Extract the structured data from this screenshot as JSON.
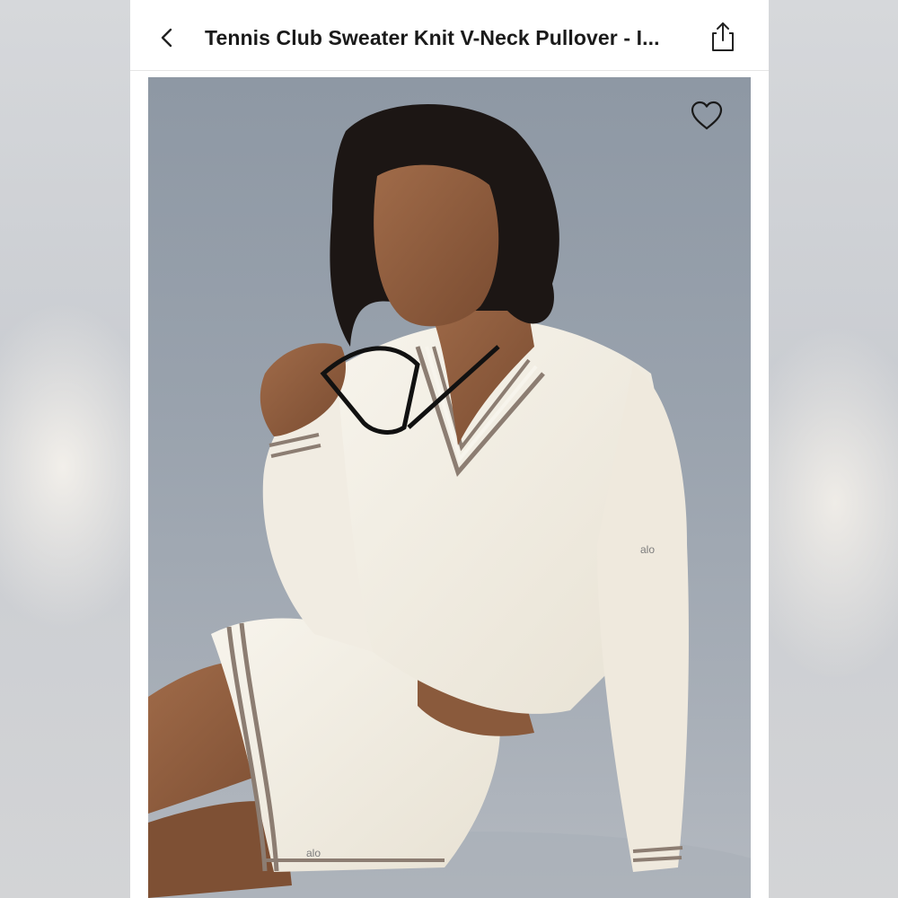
{
  "header": {
    "title": "Tennis Club Sweater Knit V-Neck Pullover - I...",
    "back_icon": "chevron-left-icon",
    "share_icon": "share-icon"
  },
  "product": {
    "image_description_icon": "product-photo",
    "favorite_icon": "heart-outline-icon",
    "logo_text": "alo",
    "colors": {
      "backdrop": "#98a1ac",
      "garment": "#f4f0e6",
      "stripe": "#8c7d72",
      "skin": "#8a5a3c",
      "hair": "#1c1614"
    }
  }
}
